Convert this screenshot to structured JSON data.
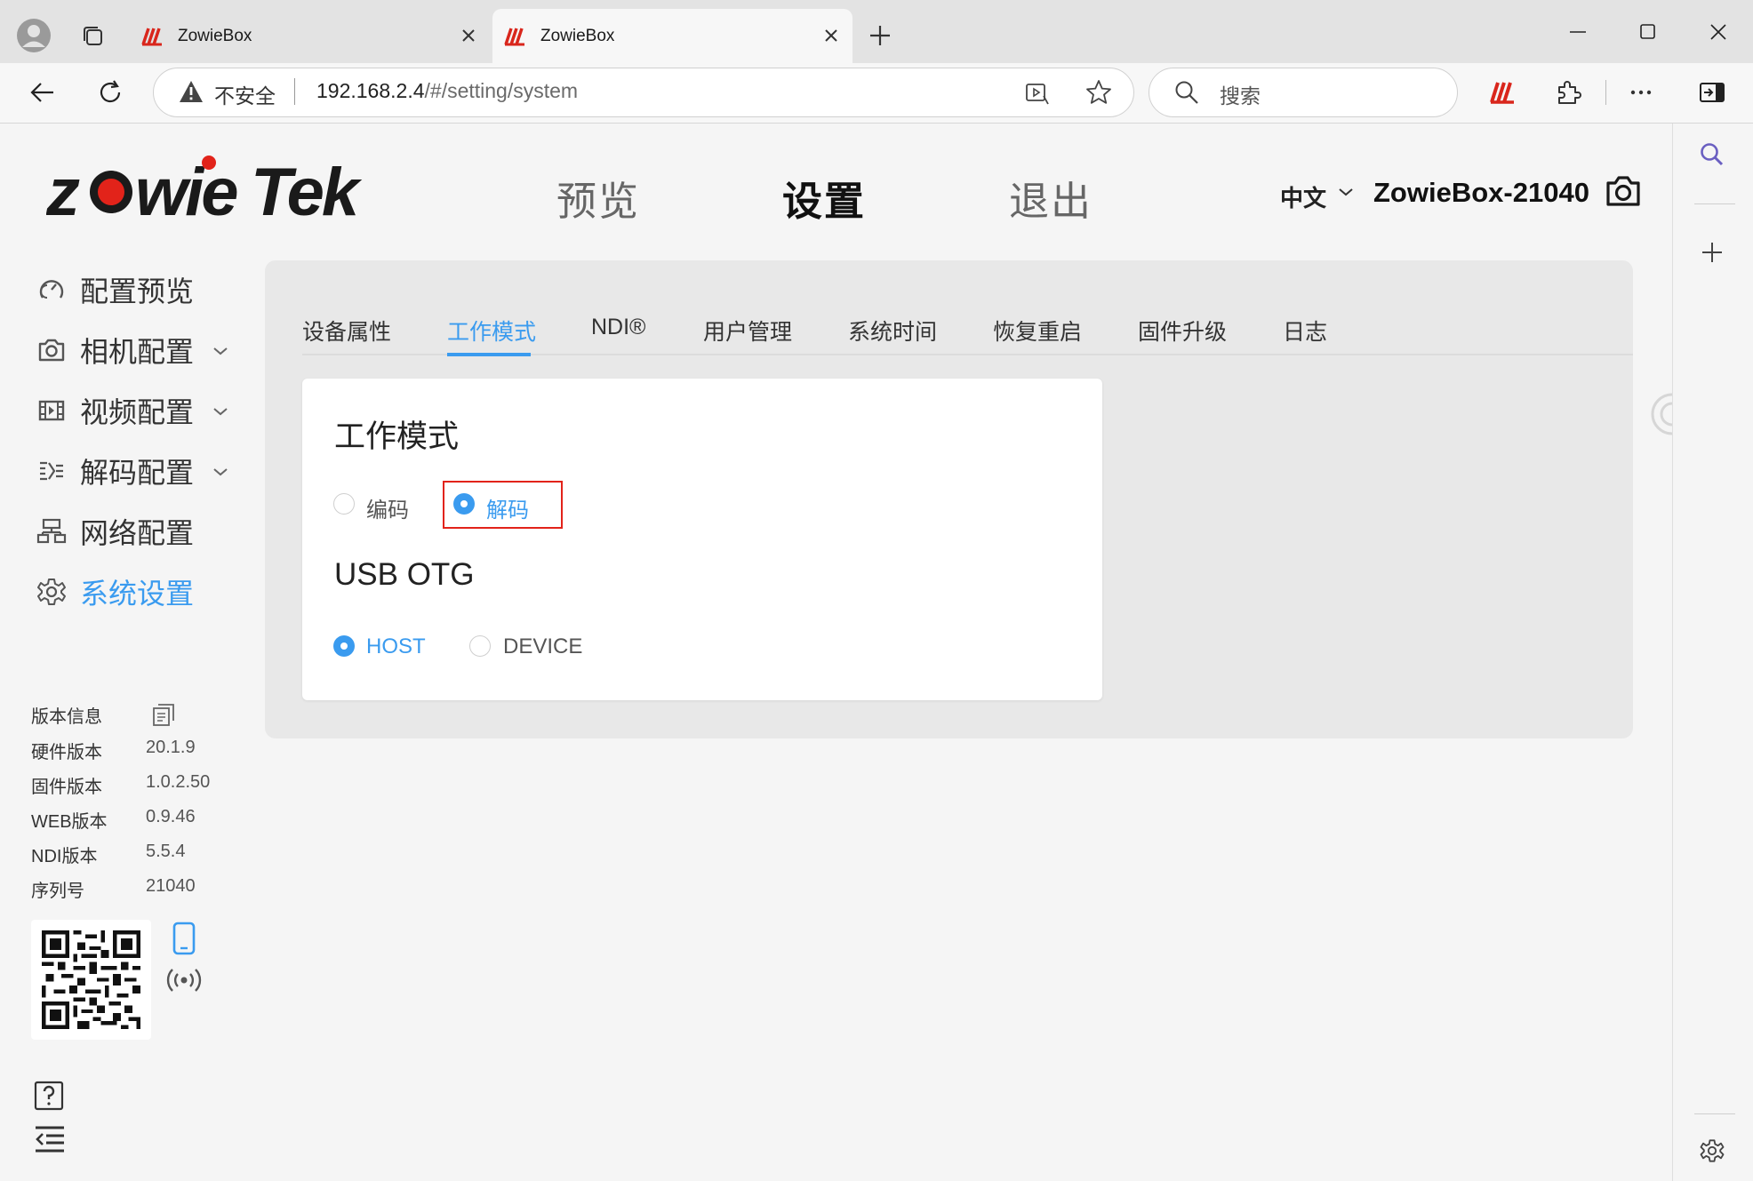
{
  "browser": {
    "tabs": [
      {
        "title": "ZowieBox",
        "active": false
      },
      {
        "title": "ZowieBox",
        "active": true
      }
    ],
    "address": {
      "security_label": "不安全",
      "url_host": "192.168.2.4",
      "url_path": "/#/setting/system"
    },
    "search": {
      "placeholder": "搜索"
    }
  },
  "header": {
    "brand": "zowieTek",
    "nav": [
      {
        "label": "预览",
        "active": false
      },
      {
        "label": "设置",
        "active": true
      },
      {
        "label": "退出",
        "active": false
      }
    ],
    "language": "中文",
    "device_name": "ZowieBox-21040"
  },
  "sidebar": {
    "items": [
      {
        "label": "配置预览",
        "icon": "dashboard-icon",
        "has_submenu": false,
        "active": false
      },
      {
        "label": "相机配置",
        "icon": "camera-icon",
        "has_submenu": true,
        "active": false
      },
      {
        "label": "视频配置",
        "icon": "film-icon",
        "has_submenu": true,
        "active": false
      },
      {
        "label": "解码配置",
        "icon": "decode-icon",
        "has_submenu": true,
        "active": false
      },
      {
        "label": "网络配置",
        "icon": "network-icon",
        "has_submenu": false,
        "active": false
      },
      {
        "label": "系统设置",
        "icon": "gear-icon",
        "has_submenu": false,
        "active": true
      }
    ],
    "info_title": "版本信息",
    "info": [
      {
        "label": "硬件版本",
        "value": "20.1.9"
      },
      {
        "label": "固件版本",
        "value": "1.0.2.50"
      },
      {
        "label": "WEB版本",
        "value": "0.9.46"
      },
      {
        "label": "NDI版本",
        "value": "5.5.4"
      },
      {
        "label": "序列号",
        "value": "21040"
      }
    ]
  },
  "settings": {
    "tabs": [
      {
        "label": "设备属性",
        "active": false
      },
      {
        "label": "工作模式",
        "active": true
      },
      {
        "label": "NDI®",
        "active": false
      },
      {
        "label": "用户管理",
        "active": false
      },
      {
        "label": "系统时间",
        "active": false
      },
      {
        "label": "恢复重启",
        "active": false
      },
      {
        "label": "固件升级",
        "active": false
      },
      {
        "label": "日志",
        "active": false
      }
    ],
    "work_mode": {
      "title": "工作模式",
      "options": [
        {
          "label": "编码",
          "checked": false
        },
        {
          "label": "解码",
          "checked": true
        }
      ]
    },
    "usb_otg": {
      "title": "USB OTG",
      "options": [
        {
          "label": "HOST",
          "checked": true
        },
        {
          "label": "DEVICE",
          "checked": false
        }
      ]
    }
  },
  "colors": {
    "accent": "#3a9bef",
    "brand_red": "#e2231a",
    "highlight": "#e2231a"
  }
}
